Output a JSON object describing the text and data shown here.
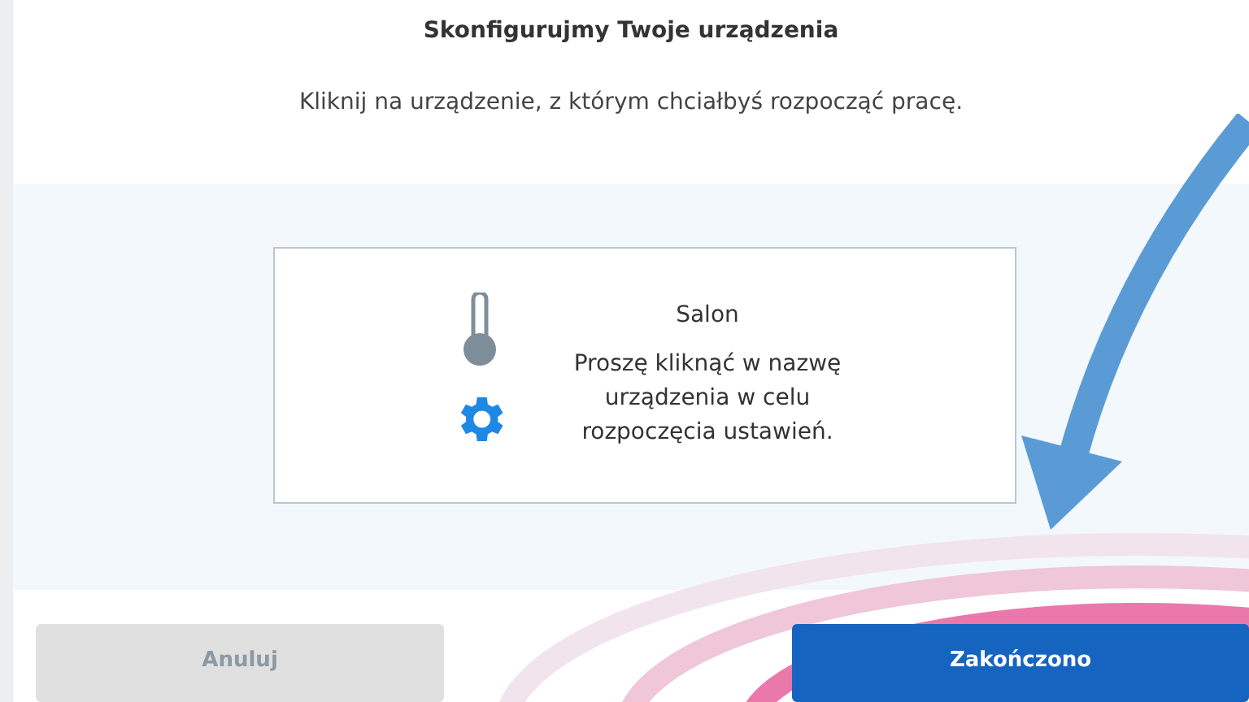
{
  "dialog": {
    "title": "Skonfigurujmy Twoje urządzenia",
    "subtitle": "Kliknij na urządzenie, z którym chciałbyś rozpocząć pracę."
  },
  "device_card": {
    "name": "Salon",
    "hint": "Proszę kliknąć w nazwę urządzenia w celu rozpoczęcia ustawień."
  },
  "buttons": [
    {
      "label": "Anuluj",
      "kind": "secondary"
    },
    {
      "label": "Zakończono",
      "kind": "primary"
    }
  ]
}
